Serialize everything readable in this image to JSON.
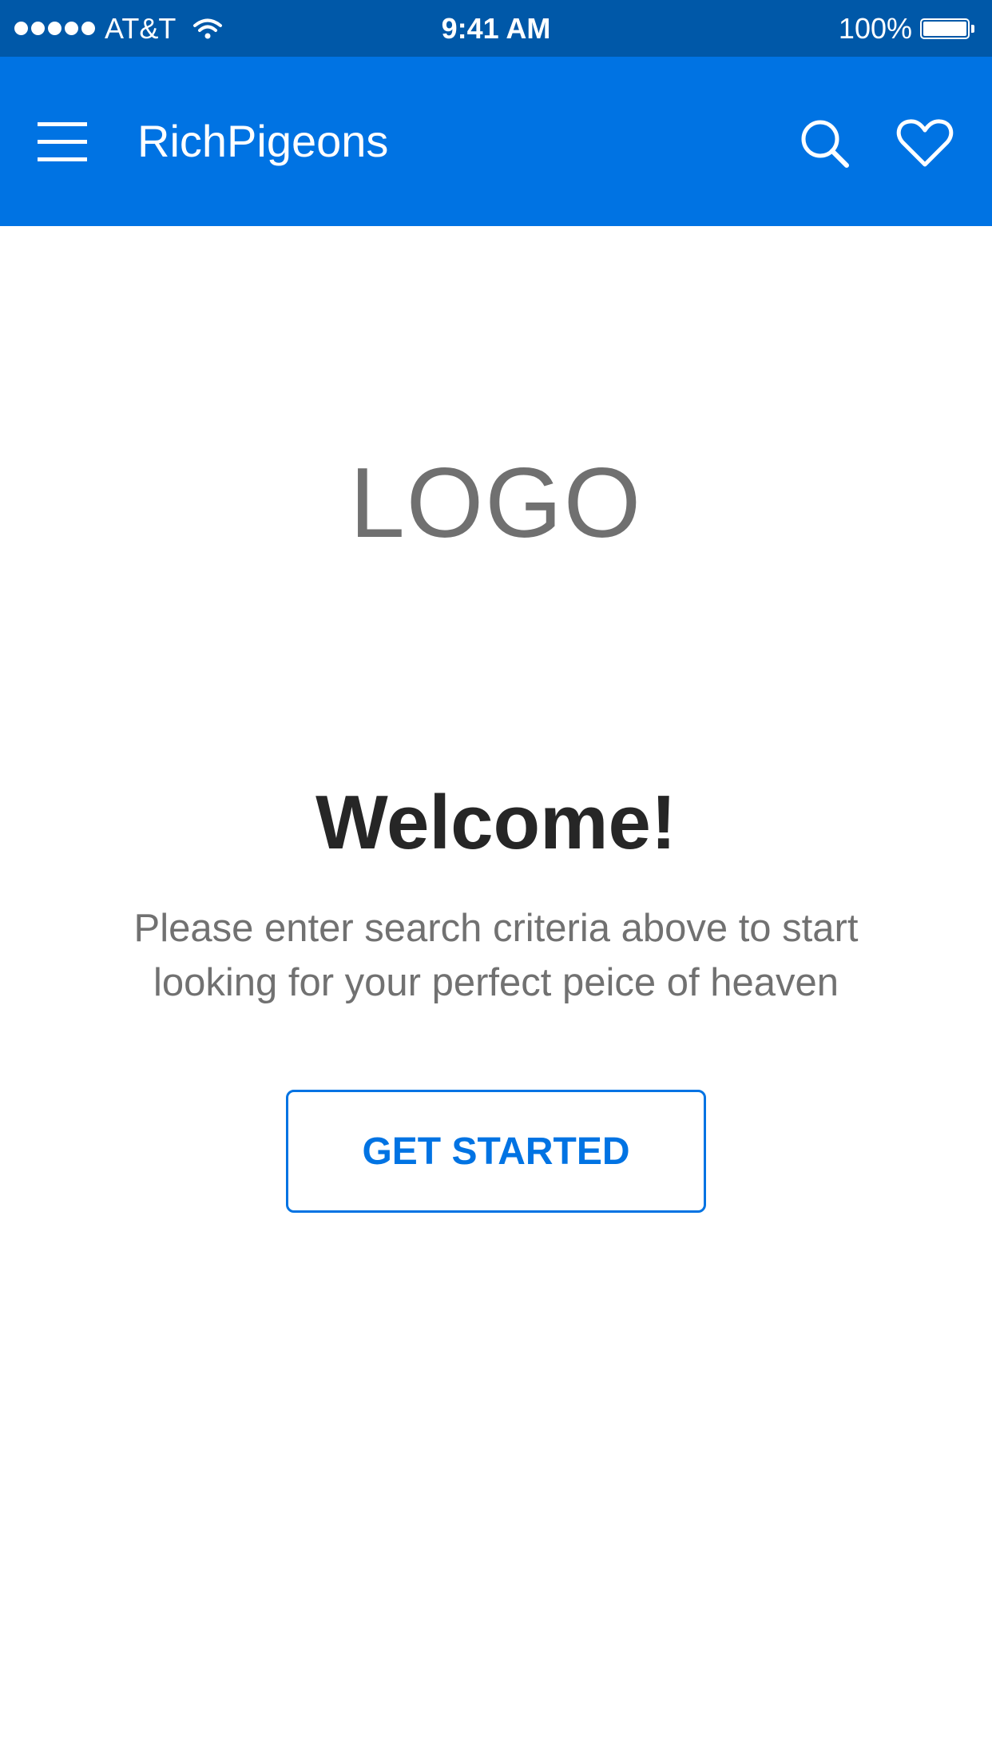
{
  "status_bar": {
    "carrier": "AT&T",
    "time": "9:41 AM",
    "battery_percent": "100%",
    "battery_level": 1.0,
    "signal_bars": 5,
    "icons": [
      "signal-dots-icon",
      "wifi-icon",
      "battery-icon"
    ]
  },
  "app_bar": {
    "title": "RichPigeons",
    "background_color": "#0073e3",
    "icons": [
      "hamburger-menu-icon",
      "search-icon",
      "heart-icon"
    ]
  },
  "main": {
    "logo_text": "LOGO",
    "welcome_heading": "Welcome!",
    "subtitle_line1": "Please enter search criteria above to start",
    "subtitle_line2": "looking for your perfect peice of heaven",
    "cta_label": "GET STARTED",
    "accent_color": "#0073e3"
  }
}
